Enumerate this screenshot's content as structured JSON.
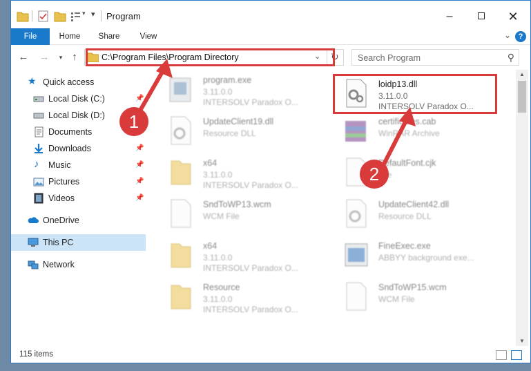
{
  "window": {
    "title": "Program",
    "controls": [
      "minimize",
      "maximize",
      "close"
    ]
  },
  "ribbon": {
    "tabs": [
      {
        "label": "File"
      },
      {
        "label": "Home"
      },
      {
        "label": "Share"
      },
      {
        "label": "View"
      }
    ]
  },
  "address": {
    "path": "C:\\Program Files\\Program Directory"
  },
  "search": {
    "placeholder": "Search Program"
  },
  "nav": {
    "quick_access": "Quick access",
    "items": [
      {
        "label": "Local Disk (C:)",
        "icon": "drive-icon",
        "pinned": true
      },
      {
        "label": "Local Disk (D:)",
        "icon": "drive-icon",
        "pinned": false
      },
      {
        "label": "Documents",
        "icon": "documents-icon",
        "pinned": true
      },
      {
        "label": "Downloads",
        "icon": "downloads-icon",
        "pinned": true
      },
      {
        "label": "Music",
        "icon": "music-icon",
        "pinned": true
      },
      {
        "label": "Pictures",
        "icon": "pictures-icon",
        "pinned": true
      },
      {
        "label": "Videos",
        "icon": "videos-icon",
        "pinned": true
      }
    ],
    "onedrive": "OneDrive",
    "thispc": "This PC",
    "network": "Network"
  },
  "files": [
    {
      "name": "program.exe",
      "line2": "3.11.0.0",
      "line3": "INTERSOLV Paradox O...",
      "icon": "exe-icon",
      "highlighted": false
    },
    {
      "name": "loidp13.dll",
      "line2": "3.11.0.0",
      "line3": "INTERSOLV Paradox O...",
      "icon": "dll-icon",
      "highlighted": true
    },
    {
      "name": "UpdateClient19.dll",
      "line2": "Resource DLL",
      "line3": "",
      "icon": "dll-icon",
      "highlighted": false
    },
    {
      "name": "certificates.cab",
      "line2": "WinRAR Archive",
      "line3": "",
      "icon": "archive-icon",
      "highlighted": false
    },
    {
      "name": "x64",
      "line2": "3.11.0.0",
      "line3": "INTERSOLV Paradox O...",
      "icon": "folder-icon",
      "highlighted": false
    },
    {
      "name": "DefaultFont.cjk",
      "line2": "File",
      "line3": "",
      "icon": "file-icon",
      "highlighted": false
    },
    {
      "name": "SndToWP13.wcm",
      "line2": "WCM File",
      "line3": "",
      "icon": "file-icon",
      "highlighted": false
    },
    {
      "name": "UpdateClient42.dll",
      "line2": "Resource DLL",
      "line3": "",
      "icon": "dll-icon",
      "highlighted": false
    },
    {
      "name": "x64",
      "line2": "3.11.0.0",
      "line3": "INTERSOLV Paradox O...",
      "icon": "folder-icon",
      "highlighted": false
    },
    {
      "name": "FineExec.exe",
      "line2": "ABBYY background exe...",
      "line3": "",
      "icon": "app-icon",
      "highlighted": false
    },
    {
      "name": "Resource",
      "line2": "3.11.0.0",
      "line3": "INTERSOLV Paradox O...",
      "icon": "folder-icon",
      "highlighted": false
    },
    {
      "name": "SndToWP15.wcm",
      "line2": "WCM File",
      "line3": "",
      "icon": "file-icon",
      "highlighted": false
    }
  ],
  "status": {
    "item_count": "115 items"
  },
  "annotations": {
    "step1": "1",
    "step2": "2",
    "color": "#d93a3a"
  },
  "colors": {
    "accent": "#1979ca",
    "selection": "#cce4f7"
  }
}
